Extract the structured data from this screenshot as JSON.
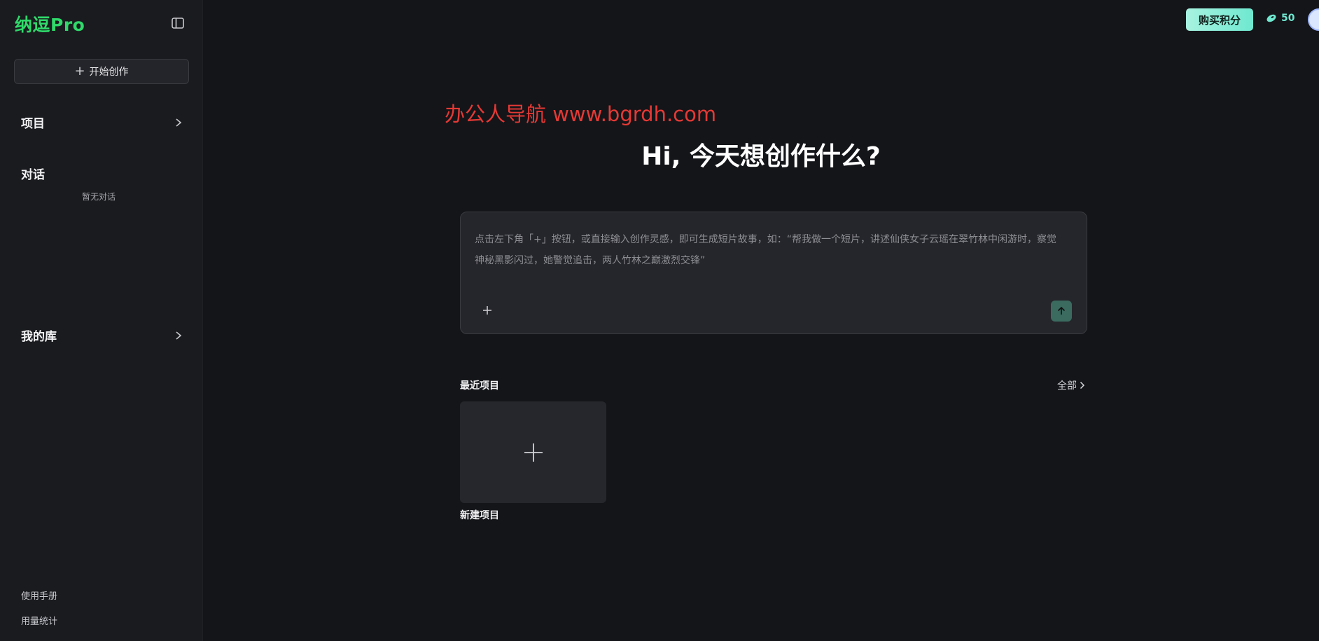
{
  "brand": {
    "name": "纳逗Pro",
    "color": "#2fd96a"
  },
  "sidebar": {
    "new_button_label": "开始创作",
    "projects_label": "项目",
    "conversations_label": "对话",
    "conversations_empty": "暂无对话",
    "library_label": "我的库",
    "footer": {
      "manual": "使用手册",
      "usage": "用量统计"
    }
  },
  "topbar": {
    "buy_points_label": "购买积分",
    "points_value": "50",
    "points_icon": "bean-icon"
  },
  "main": {
    "watermark": "办公人导航 www.bgrdh.com",
    "greeting": "Hi, 今天想创作什么?",
    "prompt_placeholder": "点击左下角「+」按钮，或直接输入创作灵感，即可生成短片故事，如：“帮我做一个短片，讲述仙侠女子云瑶在翠竹林中闲游时，察觉神秘黑影闪过，她警觉追击，两人竹林之巅激烈交锋”",
    "recent_title": "最近项目",
    "view_all_label": "全部",
    "new_project_label": "新建项目"
  },
  "colors": {
    "accent": "#6fe8d0",
    "background": "#141519",
    "sidebar_bg": "#1a1b1f",
    "watermark": "#e53935"
  }
}
